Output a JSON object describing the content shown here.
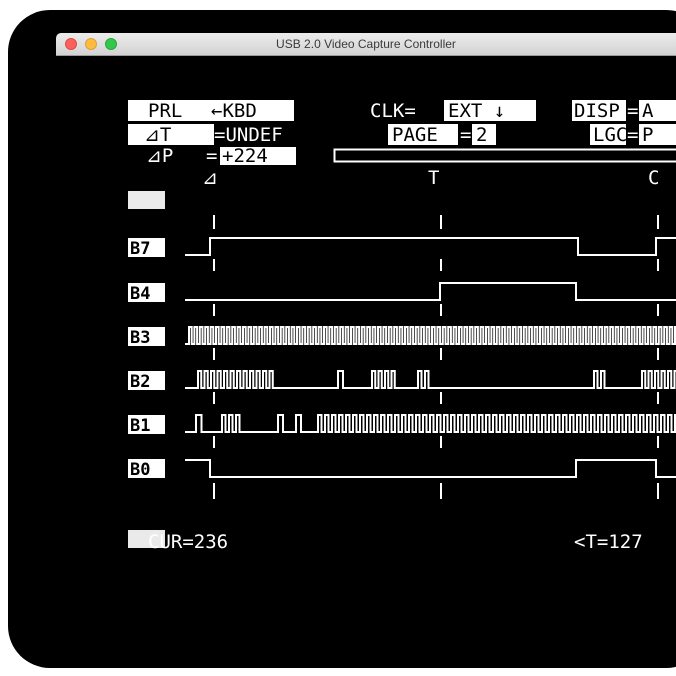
{
  "window": {
    "title": "USB 2.0 Video Capture Controller",
    "lights": {
      "close": "#fc605c",
      "minimize": "#fdbc40",
      "zoom": "#34c84a"
    }
  },
  "screen": {
    "header": {
      "prl": "PRL",
      "arrow_kbd": "←KBD",
      "clk_label": "CLK=",
      "clk_value": "EXT ↓",
      "disp_label": "DISP",
      "disp_eq": "=",
      "disp_value": "A",
      "delta_t_label": "⊿T",
      "delta_t_value": "=UNDEF",
      "page_label": "PAGE",
      "page_eq": "=",
      "page_value": "2",
      "lgc_label": "LGC",
      "lgc_eq": "=",
      "lgc_value": "P",
      "delta_p_label": "⊿P",
      "delta_p_eq": "=",
      "delta_p_value": "+224"
    },
    "markers": {
      "delta": "⊿",
      "trigger": "T",
      "cursor": "C"
    },
    "channels": [
      "B7",
      "B4",
      "B3",
      "B2",
      "B1",
      "B0"
    ],
    "footer": {
      "cur": "CUR=236",
      "t_readout": "<T=127"
    }
  }
}
